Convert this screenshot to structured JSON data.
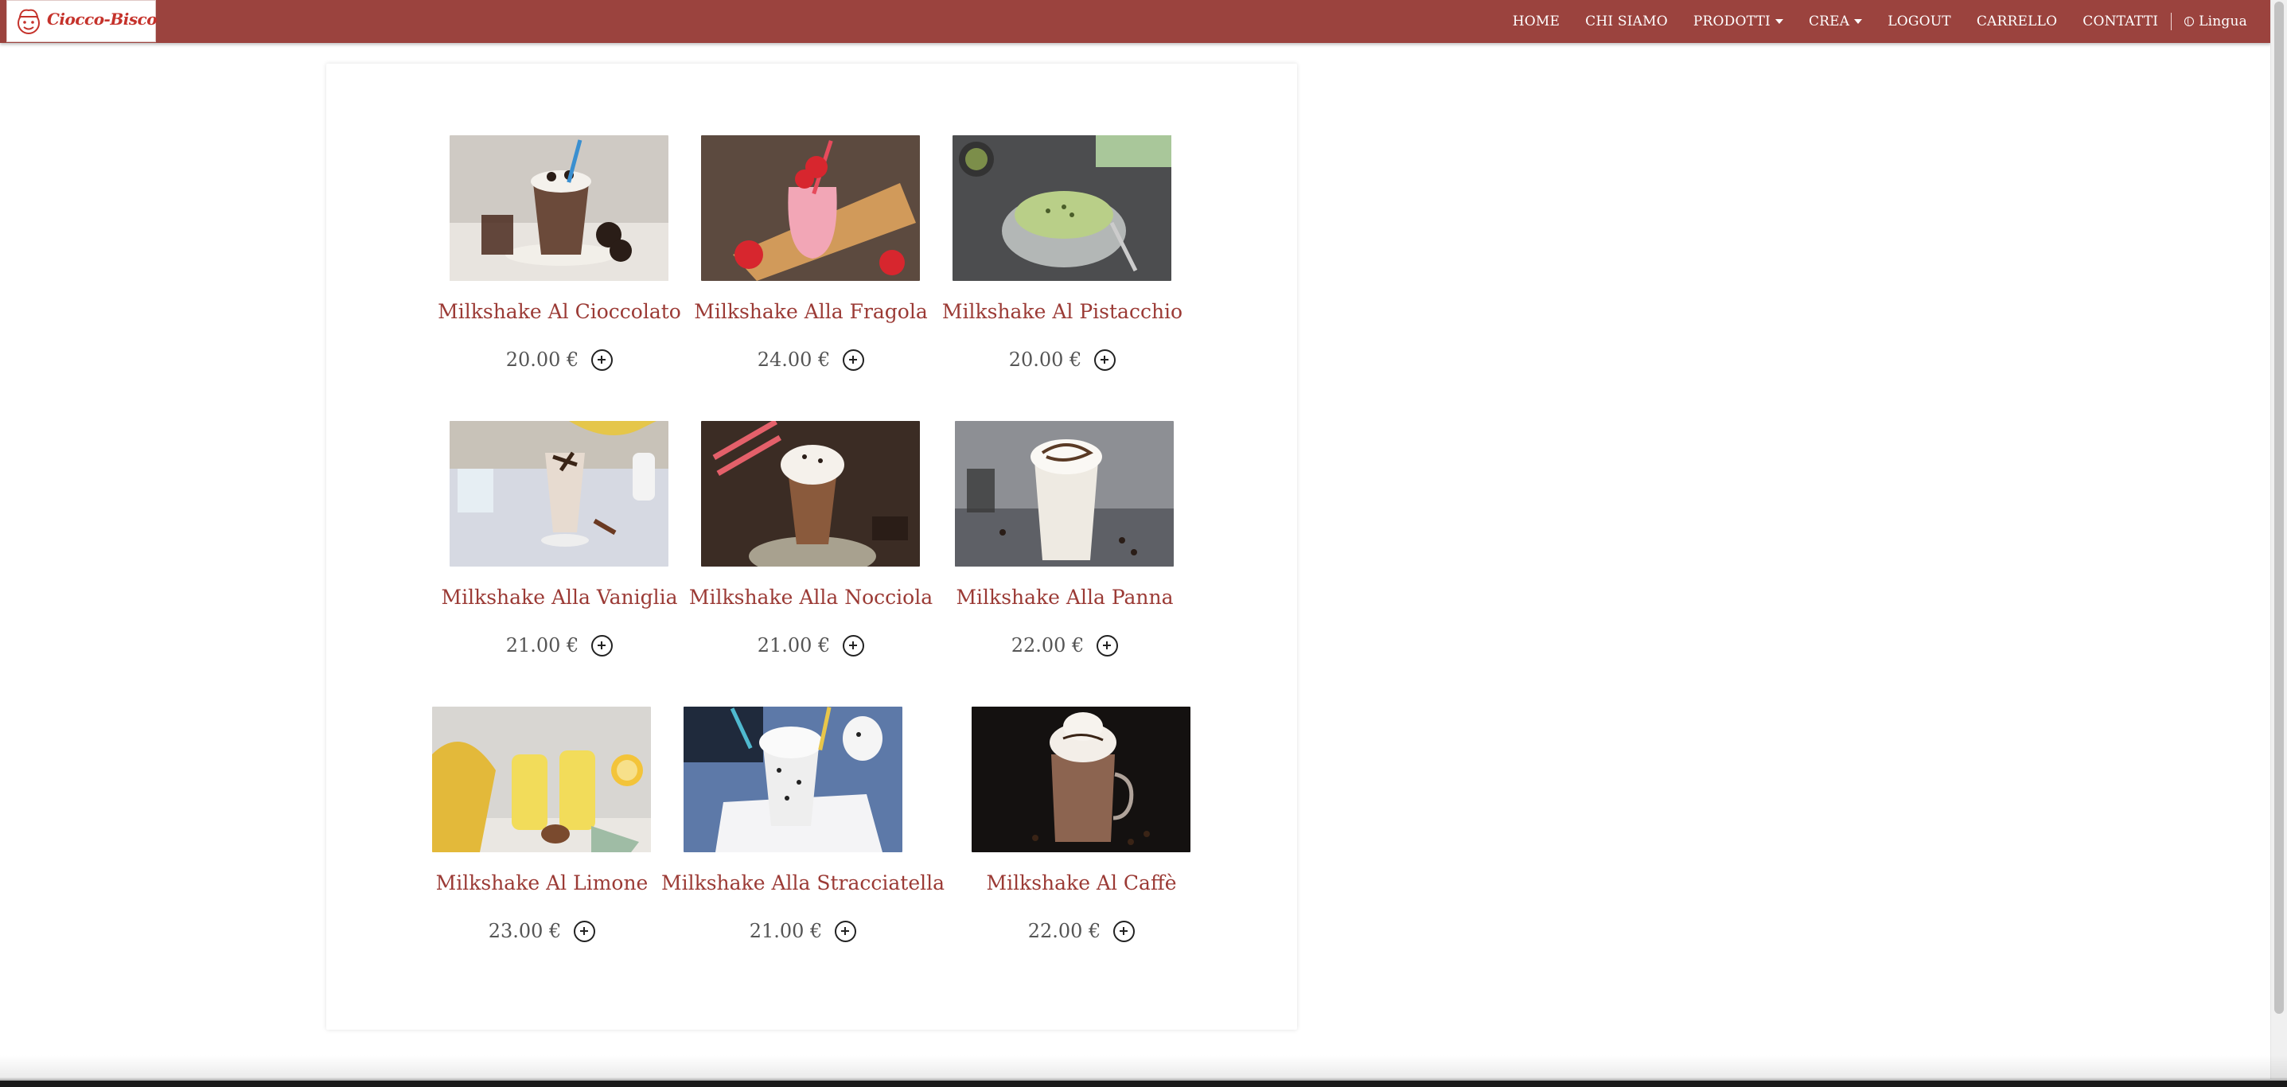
{
  "brand": {
    "logo_text": "Ciocco-Bisco",
    "logo_icon": "chef-mascot-icon"
  },
  "nav": {
    "items": [
      "HOME",
      "CHI SIAMO",
      "PRODOTTI",
      "CREA",
      "LOGOUT",
      "CARRELLO",
      "CONTATTI"
    ],
    "language_label": "Lingua",
    "language_icon": "globe-icon"
  },
  "colors": {
    "navbar": "#9b433e",
    "product_name": "#9b3a35",
    "price": "#555555"
  },
  "products": [
    {
      "name": "Milkshake Al Cioccolato",
      "price": "20.00 €",
      "image": "chocolate-milkshake-photo"
    },
    {
      "name": "Milkshake Alla Fragola",
      "price": "24.00 €",
      "image": "strawberry-milkshake-photo"
    },
    {
      "name": "Milkshake Al Pistacchio",
      "price": "20.00 €",
      "image": "pistachio-milkshake-photo"
    },
    {
      "name": "Milkshake Alla Vaniglia",
      "price": "21.00 €",
      "image": "vanilla-milkshake-photo"
    },
    {
      "name": "Milkshake Alla Nocciola",
      "price": "21.00 €",
      "image": "hazelnut-milkshake-photo"
    },
    {
      "name": "Milkshake Alla Panna",
      "price": "22.00 €",
      "image": "cream-milkshake-photo"
    },
    {
      "name": "Milkshake Al Limone",
      "price": "23.00 €",
      "image": "lemon-milkshake-photo"
    },
    {
      "name": "Milkshake Alla Stracciatella",
      "price": "21.00 €",
      "image": "stracciatella-milkshake-photo"
    },
    {
      "name": "Milkshake Al Caffè",
      "price": "22.00 €",
      "image": "coffee-milkshake-photo"
    }
  ],
  "add_icon": "plus-circle-icon"
}
